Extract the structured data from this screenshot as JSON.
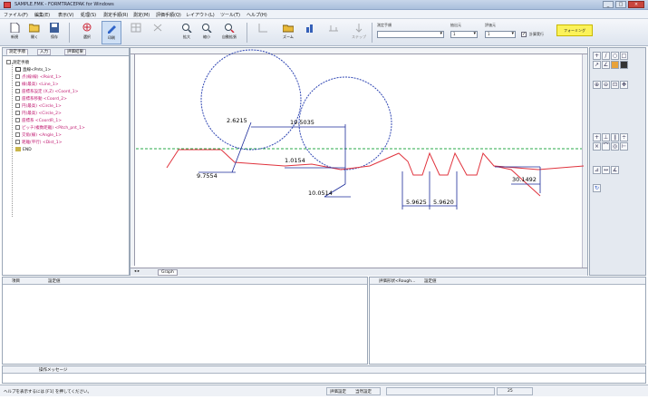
{
  "window": {
    "title": "SAMPLE.FMK - FORMTRACEPAK for Windows",
    "buttons": [
      "_",
      "□",
      "×"
    ]
  },
  "menu": [
    "ファイル(F)",
    "編集(E)",
    "表示(V)",
    "処理(S)",
    "測定手順(R)",
    "測定(M)",
    "評価手順(Q)",
    "レイアウト(L)",
    "ツール(T)",
    "ヘルプ(H)"
  ],
  "toolbar": {
    "buttons": [
      "新規",
      "開く",
      "保存",
      "",
      "選択",
      "印刷",
      "",
      "",
      "拡大",
      "縮小",
      "自動拡張",
      "",
      "ズーム",
      "",
      "",
      "ステップ"
    ],
    "procedure_label": "測定手順",
    "extract_label": "抽出元",
    "eval_label": "評価元",
    "procedure_value": "",
    "extract_value": "1",
    "eval_value": "1",
    "check_label": "計算実行",
    "yellow_button": "フォーミング"
  },
  "tree": {
    "tabs": [
      "測定手順",
      "入力",
      "評価結果"
    ],
    "root": "測定手順",
    "items": [
      "直線<Pnts_1>",
      "点(線/線) <Point_1>",
      "線(最高) <Line_1>",
      "座標系設定 (X,Z) <Coord_1>",
      "座標系移動 <Coord_2>",
      "円(最高) <Circle_1>",
      "円(最高) <Circle_2>",
      "座標系 <CoordR_1>",
      "ピッチ(複数距離) <Pitch_pnt_1>",
      "交角(線) <Angle_1>",
      "距離(平行) <Dist_1>",
      "END"
    ]
  },
  "canvas": {
    "sheet_tab": "Graph",
    "dims": [
      "2.6215",
      "19.5035",
      "1.0154",
      "9.7554",
      "10.0514",
      "5.9625",
      "5.9620",
      "30.1492"
    ]
  },
  "panels": {
    "left_head": [
      "項目",
      "設定値"
    ],
    "right_head": [
      "評価形状<Rough...",
      "設定値"
    ]
  },
  "message_bar": {
    "label": "操作メッセージ"
  },
  "statusbar": {
    "help": "ヘルプを表示するには [F1] を押してください。",
    "mode": "評価設定",
    "mode2": "当然設定",
    "num": "25"
  }
}
